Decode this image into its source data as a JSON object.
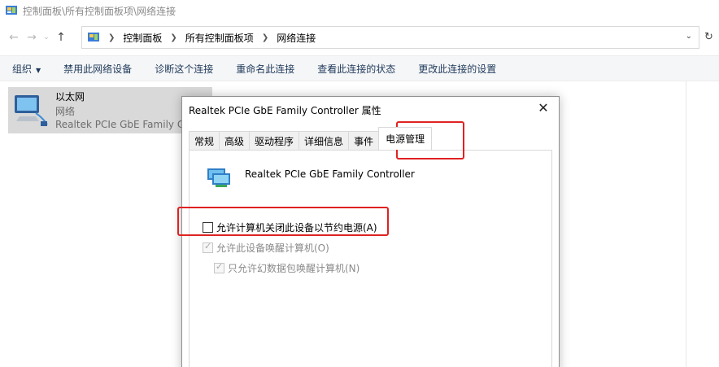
{
  "window": {
    "title": "控制面板\\所有控制面板项\\网络连接"
  },
  "address": {
    "crumbs": [
      "控制面板",
      "所有控制面板项",
      "网络连接"
    ]
  },
  "toolbar": {
    "items": [
      "组织",
      "禁用此网络设备",
      "诊断这个连接",
      "重命名此连接",
      "查看此连接的状态",
      "更改此连接的设置"
    ]
  },
  "network_item": {
    "name": "以太网",
    "status": "网络",
    "device": "Realtek PCIe GbE Family Controller"
  },
  "dialog": {
    "title": "Realtek PCIe GbE Family Controller 属性",
    "close_label": "✕",
    "tabs": [
      "常规",
      "高级",
      "驱动程序",
      "详细信息",
      "事件",
      "电源管理"
    ],
    "active_tab": "电源管理",
    "device_name": "Realtek PCIe GbE Family Controller",
    "options": [
      {
        "label": "允许计算机关闭此设备以节约电源(A)",
        "checked": false,
        "enabled": true
      },
      {
        "label": "允许此设备唤醒计算机(O)",
        "checked": true,
        "enabled": false
      },
      {
        "label": "只允许幻数据包唤醒计算机(N)",
        "checked": true,
        "enabled": false
      }
    ]
  },
  "colors": {
    "highlight": "#e02222",
    "toolbar_text": "#1e395b",
    "selected_item_bg": "#d9d9d9"
  }
}
